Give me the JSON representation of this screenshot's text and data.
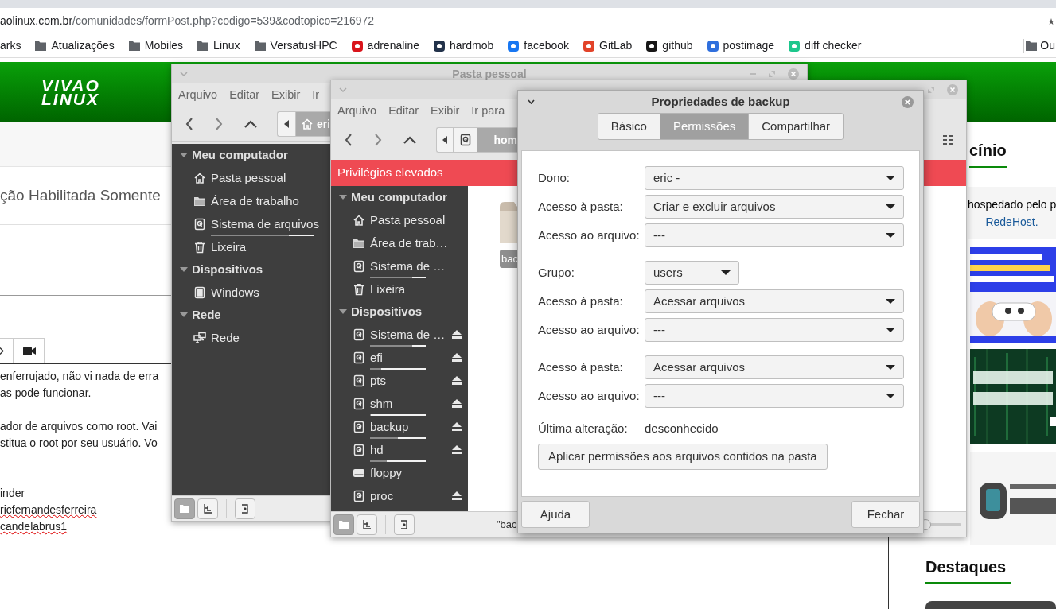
{
  "browser": {
    "url_host": "aolinux.com.br",
    "url_path": "/comunidades/formPost.php?codigo=539&codtopico=216972",
    "bookmarks": [
      {
        "label": "arks",
        "kind": "none"
      },
      {
        "label": "Atualizações",
        "kind": "folder"
      },
      {
        "label": "Mobiles",
        "kind": "folder"
      },
      {
        "label": "Linux",
        "kind": "folder"
      },
      {
        "label": "VersatusHPC",
        "kind": "folder"
      },
      {
        "label": "adrenaline",
        "kind": "site",
        "color": "#d9141b"
      },
      {
        "label": "hardmob",
        "kind": "site",
        "color": "#22324a"
      },
      {
        "label": "facebook",
        "kind": "site",
        "color": "#1877f2"
      },
      {
        "label": "GitLab",
        "kind": "site",
        "color": "#e24329"
      },
      {
        "label": "github",
        "kind": "site",
        "color": "#181717"
      },
      {
        "label": "postimage",
        "kind": "site",
        "color": "#2f6fdd"
      },
      {
        "label": "diff checker",
        "kind": "site",
        "color": "#1cc78c"
      }
    ],
    "other_bookmarks": "Ou"
  },
  "page": {
    "logo": [
      "VIVAO",
      "LINUX"
    ],
    "post_title": "ção Habilitada Somente",
    "paragraphs": [
      [
        "enferrujado, não vi nada de erra",
        "as pode funcionar."
      ],
      [
        "ador de arquivos como root. Vai",
        "stitua o root por seu usuário. Vo"
      ]
    ],
    "signature": [
      {
        "text": "inder",
        "misspelled": false
      },
      {
        "text": "ricfernandesferreira",
        "misspelled": true
      },
      {
        "text": "candelabrus1",
        "misspelled": true
      }
    ],
    "sponsor_heading": "cínio",
    "sponsor_text": "hospedado pelo p",
    "sponsor_link": "RedeHost.",
    "featured_heading": "Destaques"
  },
  "windows": [
    {
      "title": "Pasta pessoal",
      "menu": [
        "Arquivo",
        "Editar",
        "Exibir",
        "Ir"
      ],
      "path_label": "eri",
      "sidebar": [
        {
          "heading": "Meu computador",
          "expanded": true,
          "items": [
            {
              "label": "Pasta pessoal",
              "kind": "home"
            },
            {
              "label": "Área de trabalho",
              "kind": "folder"
            },
            {
              "label": "Sistema de arquivos",
              "kind": "drive",
              "level": 0.75
            },
            {
              "label": "Lixeira",
              "kind": "trash"
            }
          ]
        },
        {
          "heading": "Dispositivos",
          "expanded": true,
          "items": [
            {
              "label": "Windows",
              "kind": "chip"
            }
          ]
        },
        {
          "heading": "Rede",
          "expanded": true,
          "items": [
            {
              "label": "Rede",
              "kind": "network"
            }
          ]
        }
      ],
      "view_buttons": [
        {
          "kind": "places",
          "selected": true
        },
        {
          "kind": "tree",
          "selected": false
        },
        {
          "kind": "toggle",
          "selected": false
        }
      ]
    },
    {
      "banner": "Privilégios elevados",
      "menu": [
        "Arquivo",
        "Editar",
        "Exibir",
        "Ir para"
      ],
      "path_label": "hom",
      "sidebar": [
        {
          "heading": "Meu computador",
          "expanded": true,
          "items": [
            {
              "label": "Pasta pessoal",
              "kind": "home"
            },
            {
              "label": "Área de trab…",
              "kind": "folder"
            },
            {
              "label": "Sistema de …",
              "kind": "drive",
              "level": 0.75
            },
            {
              "label": "Lixeira",
              "kind": "trash"
            }
          ]
        },
        {
          "heading": "Dispositivos",
          "expanded": true,
          "items": [
            {
              "label": "Sistema de …",
              "kind": "drive",
              "level": 0.75,
              "ejectable": true
            },
            {
              "label": "efi",
              "kind": "drive",
              "level": 0.2,
              "ejectable": true
            },
            {
              "label": "pts",
              "kind": "drive",
              "ejectable": true
            },
            {
              "label": "shm",
              "kind": "drive",
              "level": 0.02,
              "ejectable": true
            },
            {
              "label": "backup",
              "kind": "drive",
              "level": 0.5,
              "ejectable": true
            },
            {
              "label": "hd",
              "kind": "drive",
              "level": 0.3,
              "ejectable": true
            },
            {
              "label": "floppy",
              "kind": "floppy",
              "ejectable": false
            },
            {
              "label": "proc",
              "kind": "drive",
              "ejectable": true
            }
          ]
        }
      ],
      "view_buttons": [
        {
          "kind": "places",
          "selected": true
        },
        {
          "kind": "tree",
          "selected": false
        },
        {
          "kind": "toggle",
          "selected": false
        }
      ],
      "files": [
        {
          "label": "bac"
        }
      ],
      "status": "\"bac",
      "zoom": {
        "level": 0.0
      }
    }
  ],
  "dialog": {
    "title": "Propriedades de backup",
    "tabs": [
      {
        "label": "Básico",
        "selected": false
      },
      {
        "label": "Permissões",
        "selected": true
      },
      {
        "label": "Compartilhar",
        "selected": false
      }
    ],
    "groups": [
      [
        {
          "label": "Dono:",
          "value": "eric -",
          "kind": "wide"
        },
        {
          "label": "Acesso à pasta:",
          "value": "Criar e excluir arquivos",
          "kind": "wide"
        },
        {
          "label": "Acesso ao arquivo:",
          "value": "---",
          "kind": "wide"
        }
      ],
      [
        {
          "label": "Grupo:",
          "value": "users",
          "kind": "narrow"
        },
        {
          "label": "Acesso à pasta:",
          "value": "Acessar arquivos",
          "kind": "wide"
        },
        {
          "label": "Acesso ao arquivo:",
          "value": "---",
          "kind": "wide"
        }
      ],
      [
        {
          "label": "Acesso à pasta:",
          "value": "Acessar arquivos",
          "kind": "wide"
        },
        {
          "label": "Acesso ao arquivo:",
          "value": "---",
          "kind": "wide"
        }
      ]
    ],
    "last_modified_label": "Última alteração:",
    "last_modified_value": "desconhecido",
    "apply_button": "Aplicar permissões aos arquivos contidos na pasta",
    "help_button": "Ajuda",
    "close_button": "Fechar"
  }
}
